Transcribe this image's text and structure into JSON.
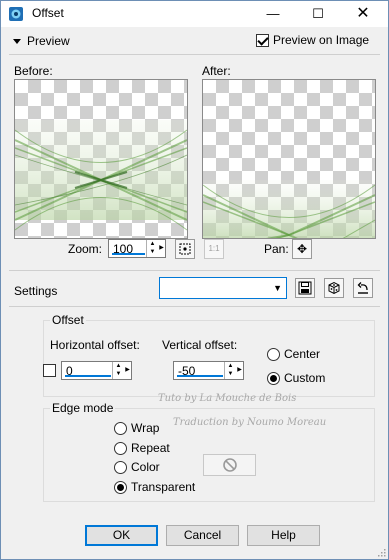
{
  "window": {
    "title": "Offset",
    "controls": {
      "minimize": "—",
      "maximize": "☐",
      "close": "✕"
    }
  },
  "preview": {
    "toggle_label": "Preview",
    "preview_on_image_label": "Preview on Image",
    "preview_on_image_checked": true,
    "before_label": "Before:",
    "after_label": "After:",
    "zoom_label": "Zoom:",
    "zoom_value": "100",
    "zoom_fit_icon": "zoom-to-fit-icon",
    "zoom_actual_icon": "1:1",
    "pan_label": "Pan:",
    "pan_icon": "✥"
  },
  "settings": {
    "label": "Settings",
    "preset_value": "",
    "save_icon": "save-preset-icon",
    "randomize_icon": "randomize-dice-icon",
    "reset_icon": "reset-icon"
  },
  "offset": {
    "group_label": "Offset",
    "horizontal_label": "Horizontal offset:",
    "horizontal_value": "0",
    "vertical_label": "Vertical offset:",
    "vertical_value": "-50",
    "center_label": "Center",
    "custom_label": "Custom",
    "selected": "Custom"
  },
  "edge_mode": {
    "group_label": "Edge mode",
    "options": [
      "Wrap",
      "Repeat",
      "Color",
      "Transparent"
    ],
    "selected": "Transparent",
    "color_swatch_icon": "no-color-icon"
  },
  "buttons": {
    "ok": "OK",
    "cancel": "Cancel",
    "help": "Help"
  },
  "watermark": [
    "Tuto by La Mouche de Bois",
    "Traduction by Noumo Moreau"
  ],
  "colors": {
    "accent": "#0078d7",
    "pattern_green": "#5a9a3a"
  }
}
